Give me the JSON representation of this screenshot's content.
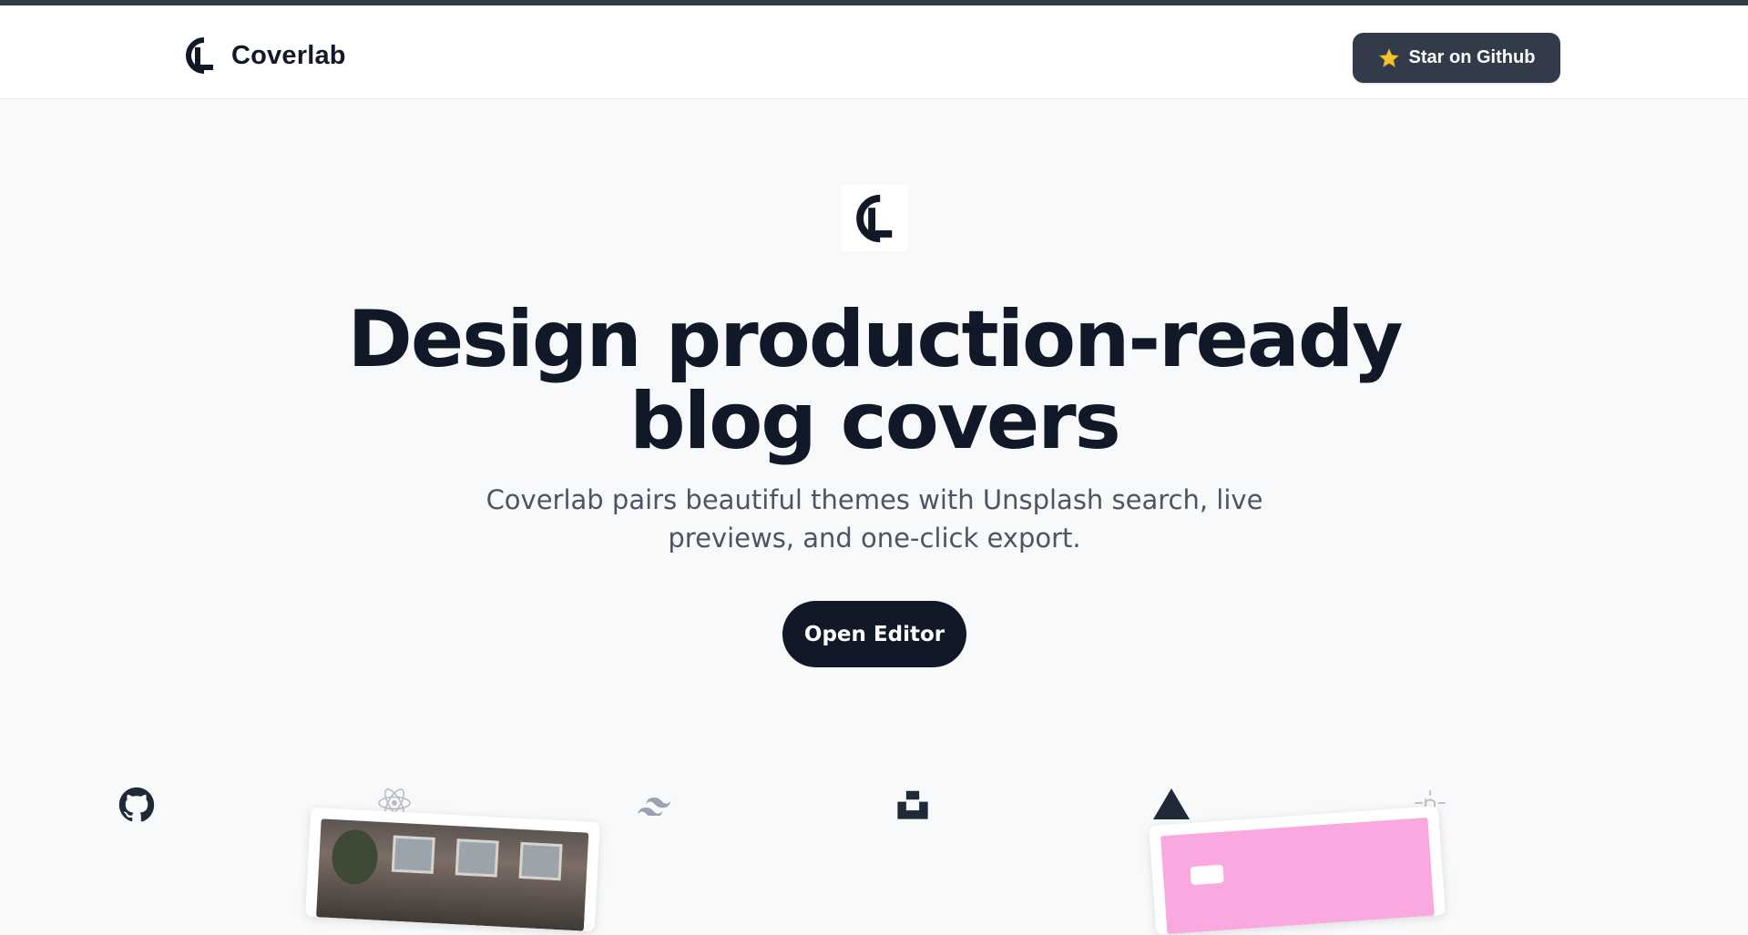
{
  "header": {
    "brand_name": "Coverlab",
    "star_label": "Star on Github"
  },
  "hero": {
    "title": "Design production-ready blog covers",
    "subtitle": "Coverlab pairs beautiful themes with Unsplash search, live previews, and one-click export.",
    "cta_label": "Open Editor"
  },
  "tech_icons": [
    "github-icon",
    "react-icon",
    "tailwind-icon",
    "unsplash-icon",
    "vercel-icon",
    "shadcn-icon"
  ],
  "colors": {
    "accent_dark": "#111827",
    "button_dark": "#333a49",
    "page_background": "#f8f9fb",
    "star_yellow": "#f5c432",
    "card_pink": "#f9a8e0"
  }
}
